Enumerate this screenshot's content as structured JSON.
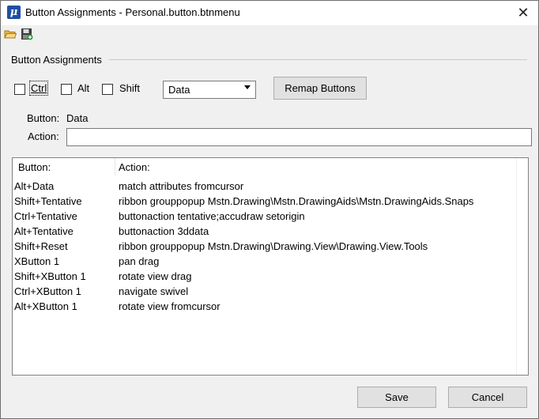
{
  "window": {
    "title": "Button Assignments - Personal.button.btnmenu",
    "app_icon_glyph": "μ"
  },
  "toolbar": {
    "open_icon": "folder-open-icon",
    "save_icon": "save-icon"
  },
  "group": {
    "title": "Button Assignments"
  },
  "modifiers": [
    {
      "label": "Ctrl",
      "checked": false
    },
    {
      "label": "Alt",
      "checked": false
    },
    {
      "label": "Shift",
      "checked": false
    }
  ],
  "button_select": {
    "value": "Data"
  },
  "remap_label": "Remap Buttons",
  "fields": {
    "button_label": "Button:",
    "button_value": "Data",
    "action_label": "Action:",
    "action_value": ""
  },
  "list": {
    "headers": [
      "Button:",
      "Action:"
    ],
    "rows": [
      [
        "Alt+Data",
        "match attributes fromcursor"
      ],
      [
        "Shift+Tentative",
        "ribbon grouppopup Mstn.Drawing\\Mstn.DrawingAids\\Mstn.DrawingAids.Snaps"
      ],
      [
        "Ctrl+Tentative",
        "buttonaction tentative;accudraw setorigin"
      ],
      [
        "Alt+Tentative",
        "buttonaction 3ddata"
      ],
      [
        "Shift+Reset",
        "ribbon grouppopup Mstn.Drawing\\Drawing.View\\Drawing.View.Tools"
      ],
      [
        "XButton 1",
        "pan drag"
      ],
      [
        "Shift+XButton 1",
        "rotate view drag"
      ],
      [
        "Ctrl+XButton 1",
        "navigate swivel"
      ],
      [
        "Alt+XButton 1",
        "rotate view fromcursor"
      ]
    ]
  },
  "footer": {
    "save_label": "Save",
    "cancel_label": "Cancel"
  },
  "colors": {
    "accent": "#1e4fa3",
    "window_bg": "#f0f0f0"
  }
}
